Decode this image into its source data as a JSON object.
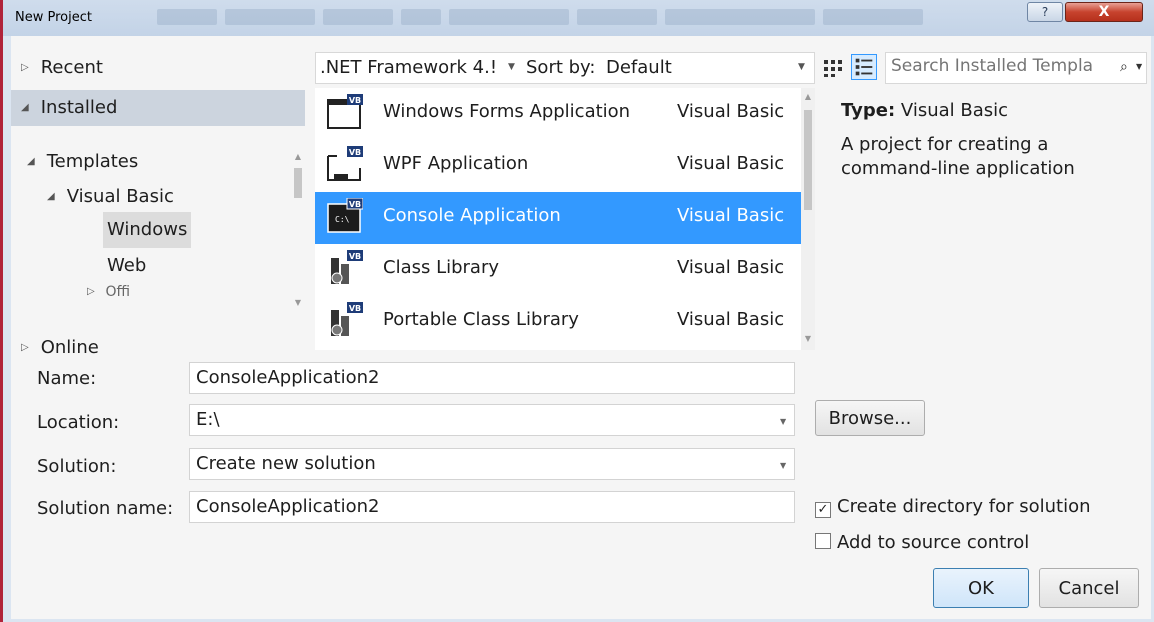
{
  "window": {
    "title": "New Project",
    "help_glyph": "?",
    "close_glyph": "X"
  },
  "tree": {
    "recent": "Recent",
    "installed": "Installed",
    "templates": "Templates",
    "visual_basic": "Visual Basic",
    "windows": "Windows",
    "web": "Web",
    "office_partial": "Offi",
    "online": "Online"
  },
  "filter": {
    "framework": ".NET Framework 4.!",
    "sort_label": "Sort by:",
    "sort_value": "Default",
    "search_placeholder": "Search Installed Templa"
  },
  "templates": [
    {
      "name": "Windows Forms Application",
      "language": "Visual Basic",
      "selected": false,
      "icon": "windows-forms-icon"
    },
    {
      "name": "WPF Application",
      "language": "Visual Basic",
      "selected": false,
      "icon": "wpf-icon"
    },
    {
      "name": "Console Application",
      "language": "Visual Basic",
      "selected": true,
      "icon": "console-icon"
    },
    {
      "name": "Class Library",
      "language": "Visual Basic",
      "selected": false,
      "icon": "class-library-icon"
    },
    {
      "name": "Portable Class Library",
      "language": "Visual Basic",
      "selected": false,
      "icon": "portable-class-library-icon"
    }
  ],
  "detail": {
    "type_label": "Type:",
    "type_value": "Visual Basic",
    "description": "A project for creating a command-line application"
  },
  "form": {
    "name_label": "Name:",
    "name_value": "ConsoleApplication2",
    "location_label": "Location:",
    "location_value": "E:\\",
    "solution_label": "Solution:",
    "solution_value": "Create new solution",
    "solution_name_label": "Solution name:",
    "solution_name_value": "ConsoleApplication2",
    "browse": "Browse...",
    "create_dir_label": "Create directory for solution",
    "create_dir_checked": true,
    "source_control_label": "Add to source control",
    "source_control_checked": false,
    "ok": "OK",
    "cancel": "Cancel"
  },
  "colors": {
    "selection": "#3399ff",
    "frame_border": "#b0233a"
  }
}
